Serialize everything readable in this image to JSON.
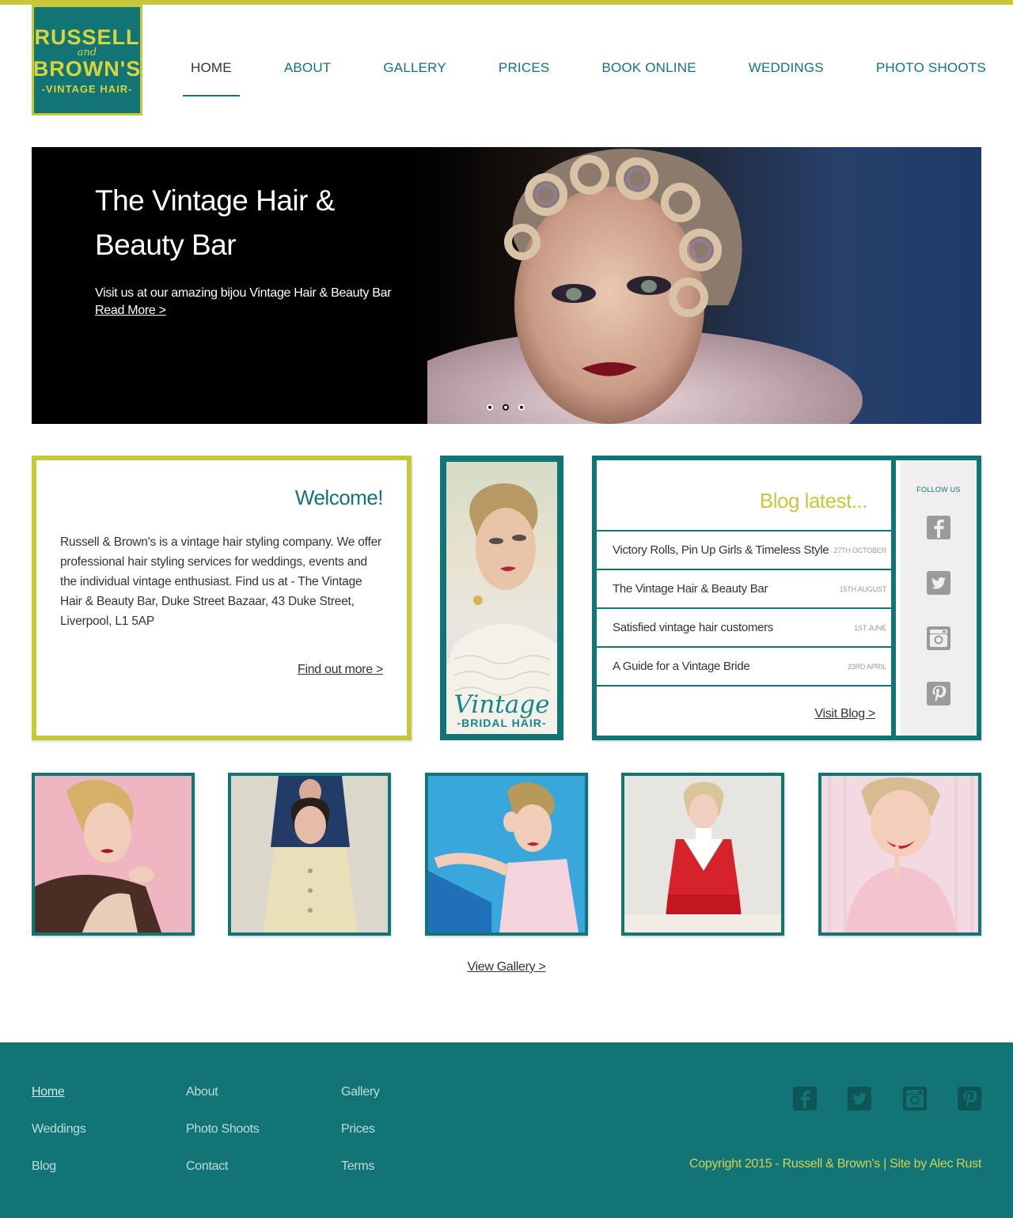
{
  "logo": {
    "line1": "RUSSELL",
    "line2": "and",
    "line3": "BROWN'S",
    "line4": "-VINTAGE HAIR-"
  },
  "nav": {
    "items": [
      {
        "label": "HOME",
        "active": true
      },
      {
        "label": "ABOUT"
      },
      {
        "label": "GALLERY"
      },
      {
        "label": "PRICES"
      },
      {
        "label": "BOOK ONLINE"
      },
      {
        "label": "WEDDINGS"
      },
      {
        "label": "PHOTO SHOOTS"
      }
    ]
  },
  "hero": {
    "title_line1": "The Vintage Hair &",
    "title_line2": "Beauty Bar",
    "subtitle": "Visit us at our amazing bijou Vintage Hair & Beauty Bar",
    "link": "Read More >",
    "slides": 3,
    "active_slide": 2
  },
  "welcome": {
    "heading": "Welcome!",
    "body": "Russell & Brown's is a vintage hair styling company. We offer professional hair styling services for weddings, events and the individual vintage enthusiast. Find us at - The Vintage Hair & Beauty Bar, Duke Street Bazaar, 43 Duke Street, Liverpool, L1 5AP",
    "link": "Find out more >"
  },
  "bridal": {
    "line1": "Vintage",
    "line2": "-BRIDAL HAIR-"
  },
  "blog": {
    "heading": "Blog latest...",
    "posts": [
      {
        "title": "Victory Rolls, Pin Up Girls & Timeless Style",
        "date": "27th October"
      },
      {
        "title": "The Vintage Hair & Beauty Bar",
        "date": "15th August"
      },
      {
        "title": "Satisfied vintage hair customers",
        "date": "1st June"
      },
      {
        "title": "A Guide for a Vintage Bride",
        "date": "23rd April"
      }
    ],
    "visit": "Visit Blog >",
    "follow": "FOLLOW US"
  },
  "gallery": {
    "link": "View Gallery >"
  },
  "footer": {
    "links": [
      {
        "label": "Home",
        "active": true
      },
      {
        "label": "About"
      },
      {
        "label": "Gallery"
      },
      {
        "label": "Weddings"
      },
      {
        "label": "Photo Shoots"
      },
      {
        "label": "Prices"
      },
      {
        "label": "Blog"
      },
      {
        "label": "Contact"
      },
      {
        "label": "Terms"
      }
    ],
    "copyright": "Copyright 2015 - Russell & Brown's | Site by Alec Rust"
  },
  "colors": {
    "teal": "#137476",
    "lime": "#c6c83a",
    "footer_text": "#b9dede"
  },
  "icons": [
    "facebook-icon",
    "twitter-icon",
    "instagram-icon",
    "pinterest-icon"
  ]
}
